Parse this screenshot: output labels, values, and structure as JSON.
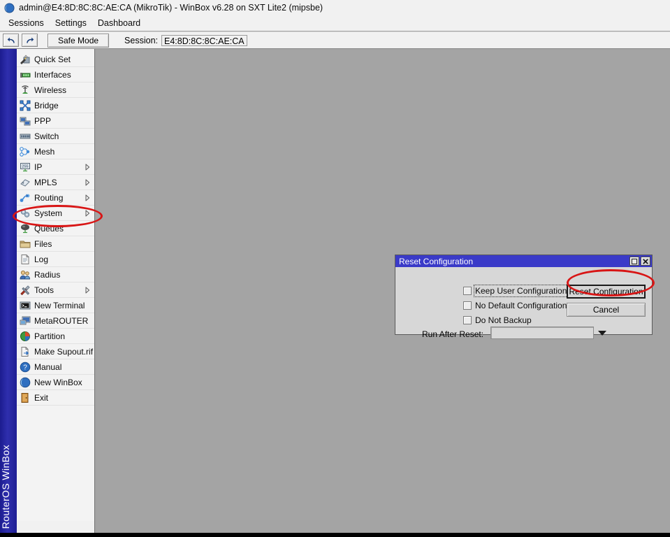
{
  "window": {
    "title": "admin@E4:8D:8C:8C:AE:CA (MikroTik) - WinBox v6.28 on SXT Lite2 (mipsbe)",
    "icon": "winbox-globe-icon",
    "vertical_brand": "RouterOS WinBox"
  },
  "menubar": {
    "items": [
      {
        "label": "Sessions"
      },
      {
        "label": "Settings"
      },
      {
        "label": "Dashboard"
      }
    ]
  },
  "toolbar": {
    "undo_label": "↶",
    "redo_label": "↷",
    "safe_mode_label": "Safe Mode",
    "session_label": "Session:",
    "session_value": "E4:8D:8C:8C:AE:CA"
  },
  "sidebar": {
    "items": [
      {
        "label": "Quick Set",
        "icon": "quick-set-icon",
        "submenu": false
      },
      {
        "label": "Interfaces",
        "icon": "interfaces-icon",
        "submenu": false
      },
      {
        "label": "Wireless",
        "icon": "wireless-icon",
        "submenu": false
      },
      {
        "label": "Bridge",
        "icon": "bridge-icon",
        "submenu": false
      },
      {
        "label": "PPP",
        "icon": "ppp-icon",
        "submenu": false
      },
      {
        "label": "Switch",
        "icon": "switch-icon",
        "submenu": false
      },
      {
        "label": "Mesh",
        "icon": "mesh-icon",
        "submenu": false
      },
      {
        "label": "IP",
        "icon": "ip-icon",
        "submenu": true
      },
      {
        "label": "MPLS",
        "icon": "mpls-icon",
        "submenu": true
      },
      {
        "label": "Routing",
        "icon": "routing-icon",
        "submenu": true
      },
      {
        "label": "System",
        "icon": "system-gear-icon",
        "submenu": true
      },
      {
        "label": "Queues",
        "icon": "queues-icon",
        "submenu": false
      },
      {
        "label": "Files",
        "icon": "files-folder-icon",
        "submenu": false
      },
      {
        "label": "Log",
        "icon": "log-icon",
        "submenu": false
      },
      {
        "label": "Radius",
        "icon": "radius-users-icon",
        "submenu": false
      },
      {
        "label": "Tools",
        "icon": "tools-icon",
        "submenu": true
      },
      {
        "label": "New Terminal",
        "icon": "terminal-icon",
        "submenu": false
      },
      {
        "label": "MetaROUTER",
        "icon": "metarouter-icon",
        "submenu": false
      },
      {
        "label": "Partition",
        "icon": "partition-pie-icon",
        "submenu": false
      },
      {
        "label": "Make Supout.rif",
        "icon": "supout-file-icon",
        "submenu": false
      },
      {
        "label": "Manual",
        "icon": "manual-help-icon",
        "submenu": false
      },
      {
        "label": "New WinBox",
        "icon": "new-winbox-icon",
        "submenu": false
      },
      {
        "label": "Exit",
        "icon": "exit-door-icon",
        "submenu": false
      }
    ]
  },
  "dialog": {
    "title": "Reset Configuration",
    "maximize_label": "□",
    "close_label": "✕",
    "checkboxes": [
      {
        "label": "Keep User Configuration",
        "checked": false,
        "focused": true
      },
      {
        "label": "No Default Configuration",
        "checked": false,
        "focused": false
      },
      {
        "label": "Do Not Backup",
        "checked": false,
        "focused": false
      }
    ],
    "run_after_reset_label": "Run After Reset:",
    "run_after_reset_value": "",
    "run_after_reset_placeholder": "",
    "buttons": [
      {
        "label": "Reset Configuration",
        "default": true
      },
      {
        "label": "Cancel",
        "default": false
      }
    ]
  },
  "annotations": [
    {
      "name": "system-highlight",
      "shape": "ellipse",
      "color": "#d81515",
      "target": "System"
    },
    {
      "name": "reset-button-highlight",
      "shape": "ellipse",
      "color": "#d81515",
      "target": "Reset Configuration"
    }
  ],
  "colors": {
    "desktop_background": "#a4a4a4",
    "chrome": "#f1f1f1",
    "dialog_titlebar": "#3a3ac8",
    "dialog_face": "#d7d7d7",
    "brand_blue": "#2f2fae",
    "annotation_red": "#d81515"
  }
}
